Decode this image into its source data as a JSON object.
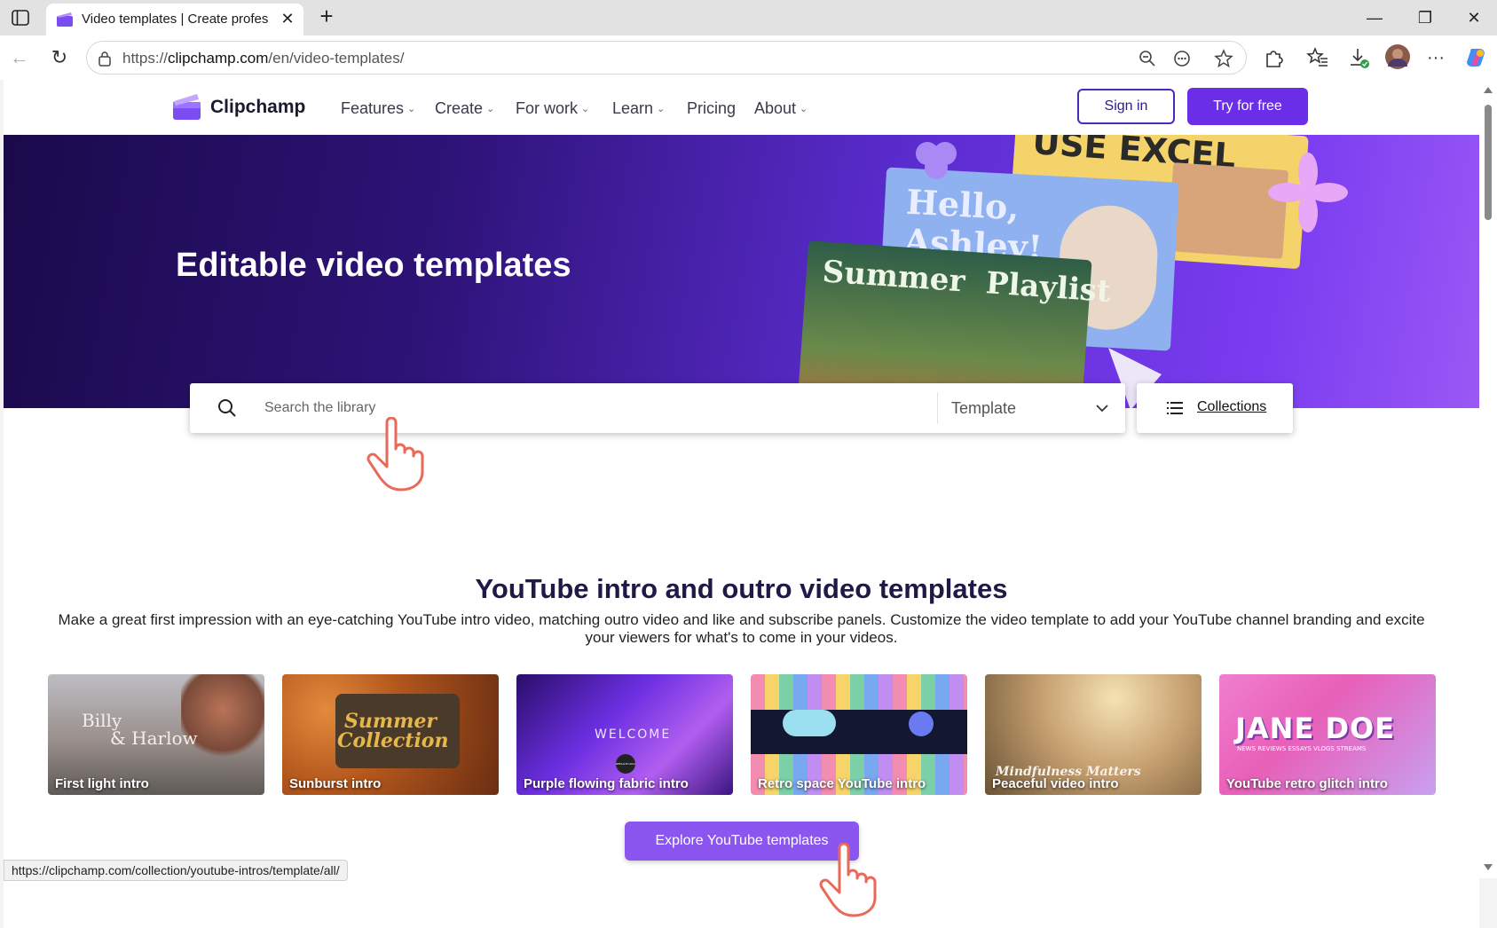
{
  "browser": {
    "tab_title": "Video templates | Create professi",
    "url_prefix": "https://",
    "url_host": "clipchamp.com",
    "url_path": "/en/video-templates/",
    "status_url": "https://clipchamp.com/collection/youtube-intros/template/all/",
    "close_glyph": "✕",
    "new_tab_glyph": "+",
    "minimize_glyph": "—",
    "restore_glyph": "❐",
    "window_close_glyph": "✕",
    "back_glyph": "←",
    "refresh_glyph": "↻",
    "more_glyph": "···"
  },
  "site": {
    "brand": "Clipchamp",
    "nav": [
      {
        "label": "Features",
        "has_menu": true
      },
      {
        "label": "Create",
        "has_menu": true
      },
      {
        "label": "For work",
        "has_menu": true
      },
      {
        "label": "Learn",
        "has_menu": true
      },
      {
        "label": "Pricing",
        "has_menu": false
      },
      {
        "label": "About",
        "has_menu": true
      }
    ],
    "chevron": "⌄",
    "sign_in": "Sign in",
    "try_free": "Try for free",
    "accent": "#6a2ee8"
  },
  "hero": {
    "title": "Editable video templates",
    "art": {
      "card1": "USE EXCEL",
      "card2_line1": "Hello,",
      "card2_line2": "Ashley!",
      "card3_line1": "Summer",
      "card3_line2": "Playlist"
    }
  },
  "search": {
    "placeholder": "Search the library",
    "type_value": "Template",
    "collections_label": "Collections"
  },
  "section": {
    "title": "YouTube intro and outro video templates",
    "description": "Make a great first impression with an eye-catching YouTube intro video, matching outro video and like and subscribe panels. Customize the video template to add your YouTube channel branding and excite your viewers for what's to come in your videos.",
    "templates": [
      {
        "label": "First light intro",
        "art_line1": "Billy",
        "art_line2": "& Harlow"
      },
      {
        "label": "Sunburst intro",
        "art_line1": "Summer",
        "art_line2": "Collection"
      },
      {
        "label": "Purple flowing fabric intro",
        "art_line1": "WELCOME",
        "art_line2": "REPLACE LOGO HERE"
      },
      {
        "label": "Retro space YouTube intro"
      },
      {
        "label": "Peaceful video intro",
        "art_line1": "Mindfulness Matters"
      },
      {
        "label": "YouTube retro glitch intro",
        "art_line1": "JANE DOE",
        "art_line2": "NEWS  REVIEWS  ESSAYS  VLOGS  STREAMS"
      }
    ],
    "explore_button": "Explore YouTube templates"
  }
}
